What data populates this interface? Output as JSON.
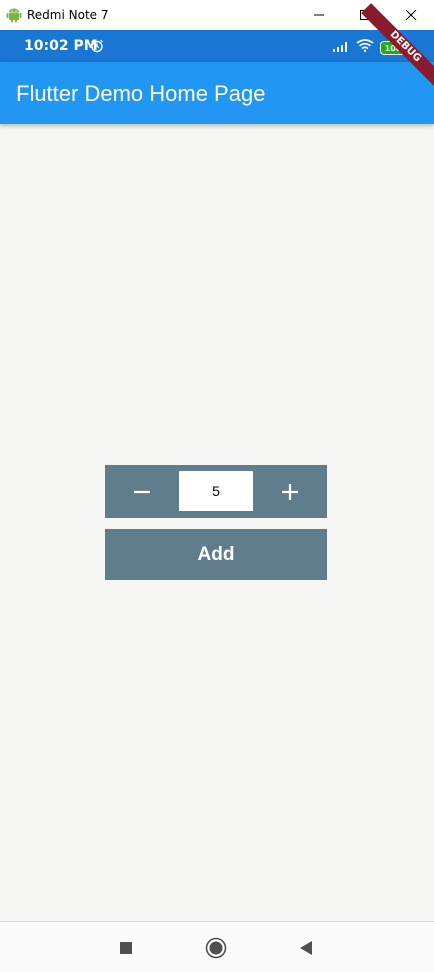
{
  "window": {
    "title": "Redmi Note 7"
  },
  "status_bar": {
    "time": "10:02 PM",
    "battery": "100"
  },
  "app_bar": {
    "title": "Flutter Demo Home Page"
  },
  "debug_banner": {
    "label": "DEBUG"
  },
  "quantity": {
    "value": "5"
  },
  "add_button": {
    "label": "Add"
  },
  "colors": {
    "app_bar": "#2196f3",
    "status_bar": "#1976d2",
    "button": "#607d8b",
    "background": "#f6f7f5"
  }
}
